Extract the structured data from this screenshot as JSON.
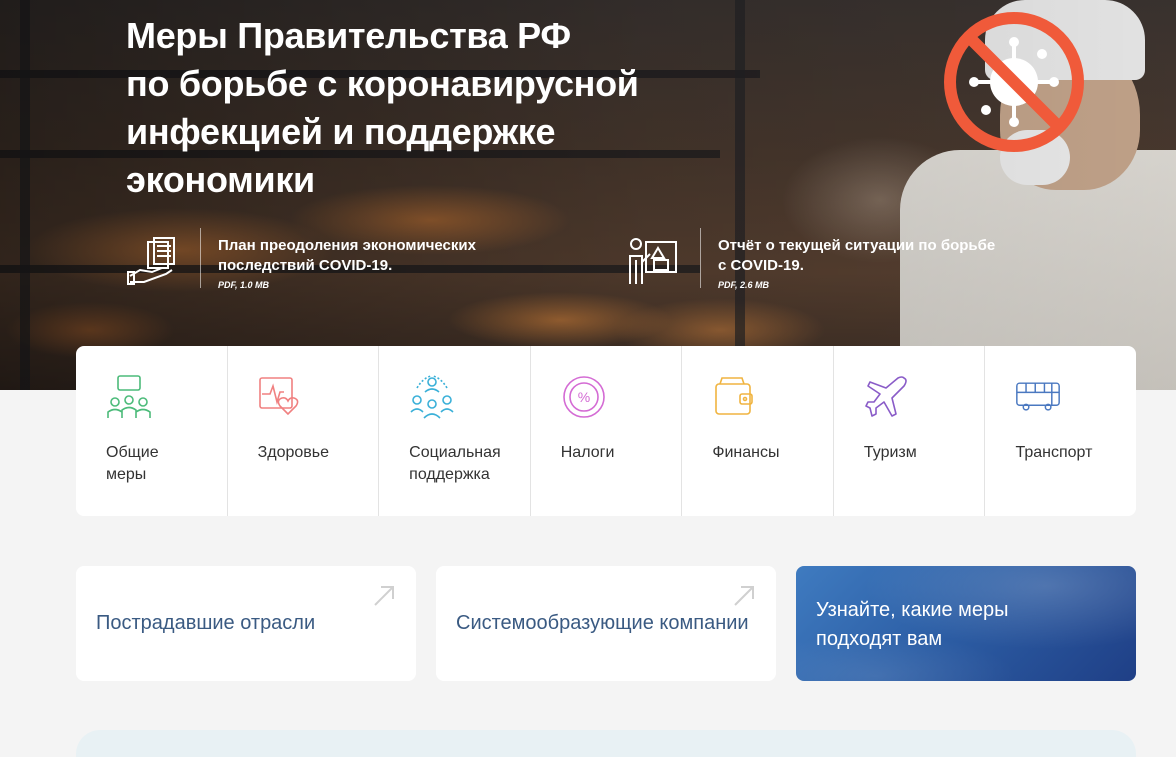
{
  "hero": {
    "title": "Меры Правительства РФ\nпо борьбе с коронавирусной\nинфекцией и поддержке\nэкономики",
    "docs": [
      {
        "icon": "hand-documents-icon",
        "title": "План преодоления экономических\nпоследствий COVID-19.",
        "meta": "PDF, 1.0 MB"
      },
      {
        "icon": "presentation-chart-icon",
        "title": "Отчёт о текущей ситуации по борьбе\nс COVID-19.",
        "meta": "PDF, 2.6 MB"
      }
    ],
    "badge_icon": "no-virus-icon",
    "badge_color": "#f05a3a"
  },
  "categories": [
    {
      "label": "Общие\nмеры",
      "icon": "people-meeting-icon",
      "color": "#4cbb7a"
    },
    {
      "label": "Здоровье",
      "icon": "heart-monitor-icon",
      "color": "#f08080"
    },
    {
      "label": "Социальная\nподдержка",
      "icon": "community-icon",
      "color": "#3ab0d8"
    },
    {
      "label": "Налоги",
      "icon": "percent-icon",
      "color": "#d46bd4"
    },
    {
      "label": "Финансы",
      "icon": "wallet-icon",
      "color": "#f0b440"
    },
    {
      "label": "Туризм",
      "icon": "airplane-icon",
      "color": "#8a5cc8"
    },
    {
      "label": "Транспорт",
      "icon": "bus-icon",
      "color": "#4a78c0"
    }
  ],
  "cards": [
    {
      "label": "Пострадавшие отрасли",
      "icon": "arrow-up-right-icon"
    },
    {
      "label": "Системообразующие компании",
      "icon": "arrow-up-right-icon"
    }
  ],
  "cta": {
    "label": "Узнайте, какие меры\nподходят вам"
  },
  "colors": {
    "link_text": "#3a5a82",
    "cta_blue": "#2d5fa6",
    "page_bg": "#f4f4f4"
  }
}
